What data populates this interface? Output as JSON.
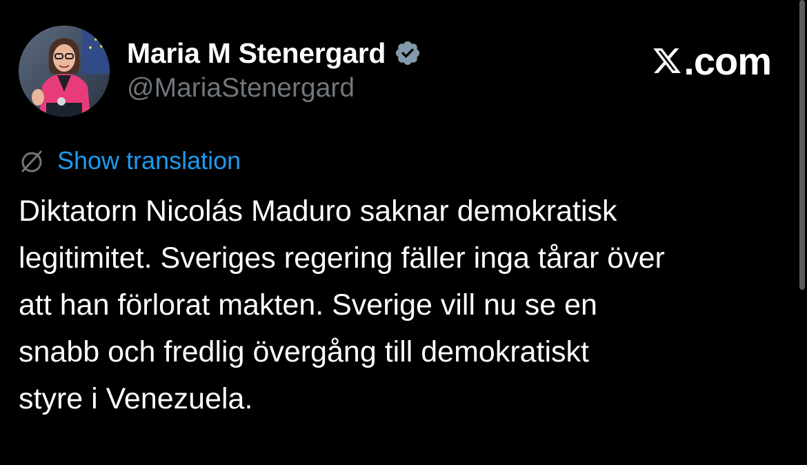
{
  "author": {
    "display_name": "Maria M Stenergard",
    "handle": "@MariaStenergard",
    "verified": true,
    "verified_badge_color": "#829aab"
  },
  "brand": {
    "text": ".com",
    "icon": "x-logo-icon"
  },
  "translation": {
    "icon": "globe-icon",
    "label": "Show translation",
    "color": "#1d9bf0"
  },
  "tweet": {
    "lines": [
      "Diktatorn Nicolás Maduro saknar demokratisk",
      "legitimitet. Sveriges regering fäller inga tårar över",
      "att han förlorat makten. Sverige vill nu se en",
      "snabb och fredlig övergång till demokratiskt",
      "styre i Venezuela."
    ]
  },
  "colors": {
    "background": "#000000",
    "text": "#ffffff",
    "secondary_text": "#71767b"
  }
}
